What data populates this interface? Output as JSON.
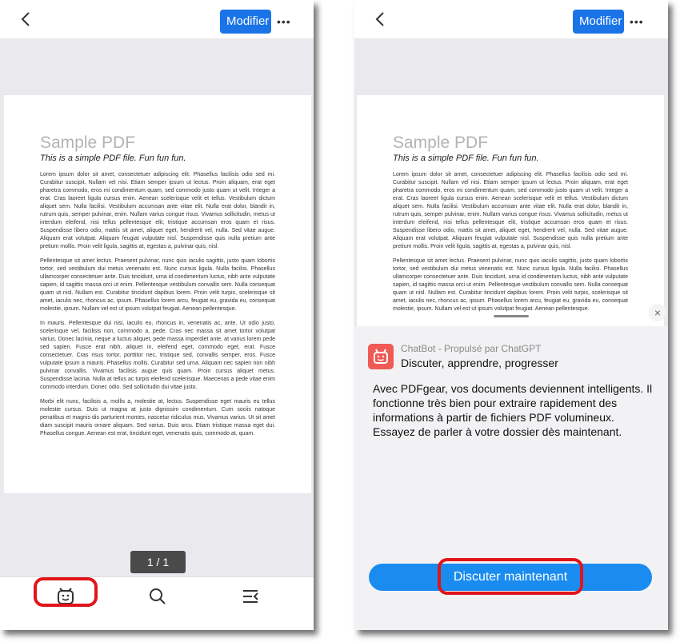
{
  "toolbar": {
    "modify_label": "Modifier",
    "more_label": "•••"
  },
  "pdf": {
    "title": "Sample PDF",
    "subtitle": "This is a simple PDF file. Fun fun fun.",
    "paragraphs": [
      "Lorem ipsum dolor sit amet, consectetuer adipiscing elit. Phasellus facilisis odio sed mi. Curabitur suscipit. Nullam vel nisi. Etiam semper ipsum ut lectus. Proin aliquam, erat eget pharetra commodo, eros mi condimentum quam, sed commodo justo quam ut velit. Integer a erat. Cras laoreet ligula cursus enim. Aenean scelerisque velit et tellus. Vestibulum dictum aliquet sem. Nulla facilisi. Vestibulum accumsan ante vitae elit. Nulla erat dolor, blandit in, rutrum quis, semper pulvinar, enim. Nullam varius congue risus. Vivamus sollicitudin, metus ut interdum eleifend, nisi tellus pellentesque elit, tristique accumsan eros quam et risus. Suspendisse libero odio, mattis sit amet, aliquet eget, hendrerit vel, nulla. Sed vitae augue. Aliquam erat volutpat. Aliquam feugiat vulputate nisl. Suspendisse quis nulla pretium ante pretium mollis. Proin velit ligula, sagittis at, egestas a, pulvinar quis, nisl.",
      "Pellentesque sit amet lectus. Praesent pulvinar, nunc quis iaculis sagittis, justo quam lobortis tortor, sed vestibulum dui metus venenatis est. Nunc cursus ligula. Nulla facilisi. Phasellus ullamcorper consectetuer ante. Duis tincidunt, urna id condimentum luctus, nibh ante vulputate sapien, id sagittis massa orci ut enim. Pellentesque vestibulum convallis sem. Nulla consequat quam ut nisl. Nullam est. Curabitur tincidunt dapibus lorem. Proin velit turpis, scelerisque sit amet, iaculis nec, rhoncus ac, ipsum. Phasellus lorem arcu, feugiat eu, gravida eu, consequat molestie, ipsum. Nullam vel est ut ipsum volutpat feugiat. Aenean pellentesque.",
      "In mauris. Pellentesque dui nisi, iaculis eu, rhoncus in, venenatis ac, ante. Ut odio justo, scelerisque vel, facilisis non, commodo a, pede. Cras nec massa sit amet tortor volutpat varius. Donec lacinia, neque a luctus aliquet, pede massa imperdiet ante, at varius lorem pede sed sapien. Fusce erat nibh, aliquet in, eleifend eget, commodo eget, erat. Fusce consectetuer. Cras risus tortor, porttitor nec, tristique sed, convallis semper, eros. Fusce vulputate ipsum a mauris. Phasellus mollis. Curabitur sed urna. Aliquam nec sapien non nibh pulvinar convallis. Vivamus facilisis augue quis quam. Proin cursus aliquet metus. Suspendisse lacinia. Nulla at tellus ac turpis eleifend scelerisque. Maecenas a pede vitae enim commodo interdum. Donec odio. Sed sollicitudin dui vitae justo.",
      "Morbi elit nunc, facilisis a, mollis a, molestie at, lectus. Suspendisse eget mauris eu tellus molestie cursus. Duis ut magna at justo dignissim condimentum. Cum sociis natoque penatibus et magnis dis parturient montes, nascetur ridiculus mus. Vivamus varius. Ut sit amet diam suscipit mauris ornare aliquam. Sed varius. Duis arcu. Etiam tristique massa eget dui. Phasellus congue. Aenean est erat, tincidunt eget, venenatis quis, commodo at, quam."
    ]
  },
  "pager": {
    "label": "1 / 1"
  },
  "chatbot": {
    "brand": "ChatBot - Propulsé par ChatGPT",
    "tagline": "Discuter, apprendre, progresser",
    "description": "Avec PDFgear, vos documents deviennent intelligents.  Il fonctionne très bien pour extraire rapidement des informations à partir de fichiers PDF volumineux.  Essayez de parler à votre dossier dès maintenant.",
    "cta": "Discuter maintenant",
    "close": "×"
  }
}
